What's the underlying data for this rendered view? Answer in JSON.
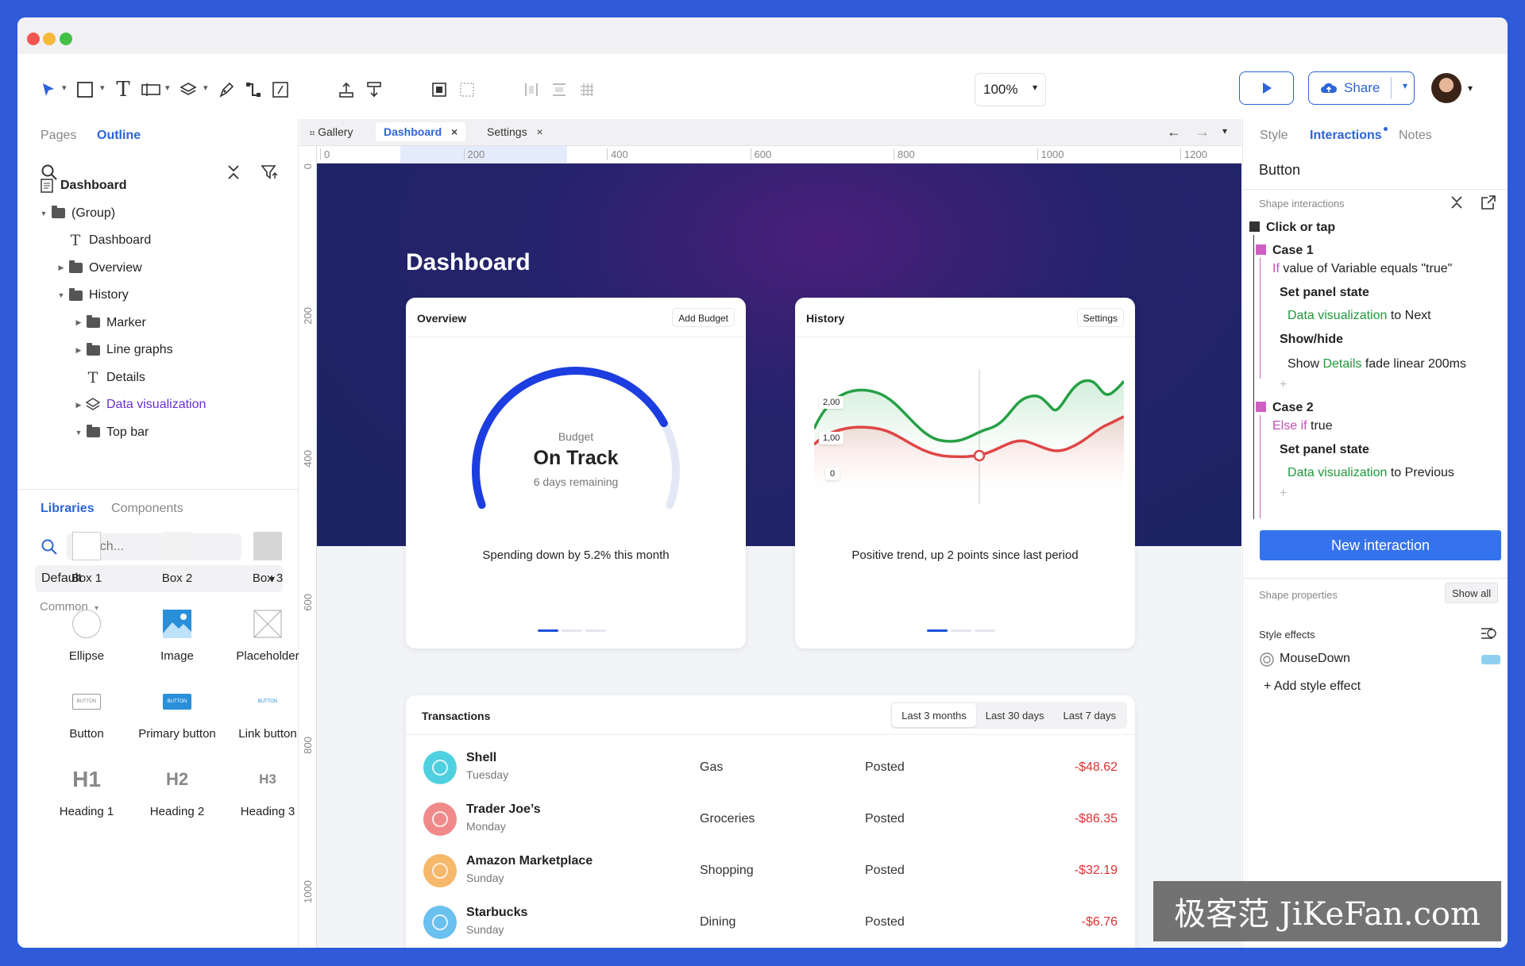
{
  "toolbar": {
    "zoom": "100%",
    "share_label": "Share"
  },
  "left_panel": {
    "tabs": [
      "Pages",
      "Outline"
    ],
    "active_tab": "Outline",
    "tree": [
      {
        "label": "Dashboard",
        "icon": "page-icon",
        "level": 0,
        "arrow": ""
      },
      {
        "label": "(Group)",
        "icon": "folder-icon",
        "level": 0,
        "arrow": "down"
      },
      {
        "label": "Dashboard",
        "icon": "text-icon",
        "level": 1,
        "arrow": ""
      },
      {
        "label": "Overview",
        "icon": "folder-icon",
        "level": 1,
        "arrow": "right"
      },
      {
        "label": "History",
        "icon": "folder-icon",
        "level": 1,
        "arrow": "down"
      },
      {
        "label": "Marker",
        "icon": "folder-icon",
        "level": 2,
        "arrow": "right"
      },
      {
        "label": "Line graphs",
        "icon": "folder-icon",
        "level": 2,
        "arrow": "right"
      },
      {
        "label": "Details",
        "icon": "text-icon",
        "level": 2,
        "arrow": ""
      },
      {
        "label": "Data visualization",
        "icon": "layers-icon",
        "level": 2,
        "arrow": "right",
        "color": "#6b2fd0"
      },
      {
        "label": "Top bar",
        "icon": "folder-icon",
        "level": 2,
        "arrow": "down"
      }
    ],
    "lib_tabs": [
      "Libraries",
      "Components"
    ],
    "search_placeholder": "Search...",
    "library_select": "Default",
    "category": "Common",
    "items": [
      [
        "Box 1",
        "Box 2",
        "Box 3"
      ],
      [
        "Ellipse",
        "Image",
        "Placeholder"
      ],
      [
        "Button",
        "Primary button",
        "Link button"
      ],
      [
        "Heading 1",
        "Heading 2",
        "Heading 3"
      ]
    ],
    "button_thumb": "BUTTON",
    "heading_thumbs": [
      "H1",
      "H2",
      "H3"
    ]
  },
  "center": {
    "tabs": [
      {
        "label": "Gallery",
        "active": false,
        "close": false
      },
      {
        "label": "Dashboard",
        "active": true,
        "close": true
      },
      {
        "label": "Settings",
        "active": false,
        "close": true
      }
    ],
    "ruler_h": [
      "0",
      "200",
      "400",
      "600",
      "800",
      "1000",
      "1200"
    ],
    "ruler_v": [
      "0",
      "200",
      "400",
      "600",
      "800",
      "1000"
    ],
    "page_title": "Dashboard",
    "overview": {
      "title": "Overview",
      "button": "Add Budget",
      "gauge_label": "Budget",
      "gauge_value": "On Track",
      "gauge_sub": "6 days remaining",
      "gauge_progress": 0.78,
      "caption": "Spending down by 5.2% this month"
    },
    "history": {
      "title": "History",
      "button": "Settings",
      "y_labels": [
        "2,00",
        "1,00",
        "0"
      ],
      "caption": "Positive trend, up 2 points since last period"
    },
    "transactions": {
      "title": "Transactions",
      "filters": [
        "Last 3 months",
        "Last 30 days",
        "Last 7 days"
      ],
      "active_filter": "Last 3 months",
      "rows": [
        {
          "name": "Shell",
          "day": "Tuesday",
          "category": "Gas",
          "status": "Posted",
          "amount": "-$48.62",
          "color": "#4fd0e0"
        },
        {
          "name": "Trader Joe’s",
          "day": "Monday",
          "category": "Groceries",
          "status": "Posted",
          "amount": "-$86.35",
          "color": "#f08a8a"
        },
        {
          "name": "Amazon Marketplace",
          "day": "Sunday",
          "category": "Shopping",
          "status": "Posted",
          "amount": "-$32.19",
          "color": "#f6b86a"
        },
        {
          "name": "Starbucks",
          "day": "Sunday",
          "category": "Dining",
          "status": "Posted",
          "amount": "-$6.76",
          "color": "#6ac0ee"
        }
      ]
    }
  },
  "right_panel": {
    "tabs": [
      "Style",
      "Interactions",
      "Notes"
    ],
    "active_tab": "Interactions",
    "element_name": "Button",
    "shape_interactions": "Shape interactions",
    "event": "Click or tap",
    "case1": {
      "title": "Case 1",
      "cond_kw": "If",
      "cond": " value of Variable equals \"true\"",
      "action1": "Set panel state",
      "action1_target": "Data visualization",
      "action1_rest": " to Next",
      "action2": "Show/hide",
      "action2_pre": "Show ",
      "action2_target": "Details",
      "action2_rest": " fade linear 200ms"
    },
    "case2": {
      "title": "Case 2",
      "cond_kw": "Else if",
      "cond": " true",
      "action1": "Set panel state",
      "action1_target": "Data visualization",
      "action1_rest": " to Previous"
    },
    "plus": "+",
    "new_interaction": "New interaction",
    "shape_properties": "Shape properties",
    "show_all": "Show all",
    "style_effects": "Style effects",
    "mousedown": "MouseDown",
    "add_style_effect": "+ Add style effect"
  },
  "watermark": "极客范 JiKeFan.com",
  "colors": {
    "accent": "#2d64d8",
    "primary_button": "#3573ec",
    "negative": "#d33333",
    "positive": "#1f9a3a"
  }
}
